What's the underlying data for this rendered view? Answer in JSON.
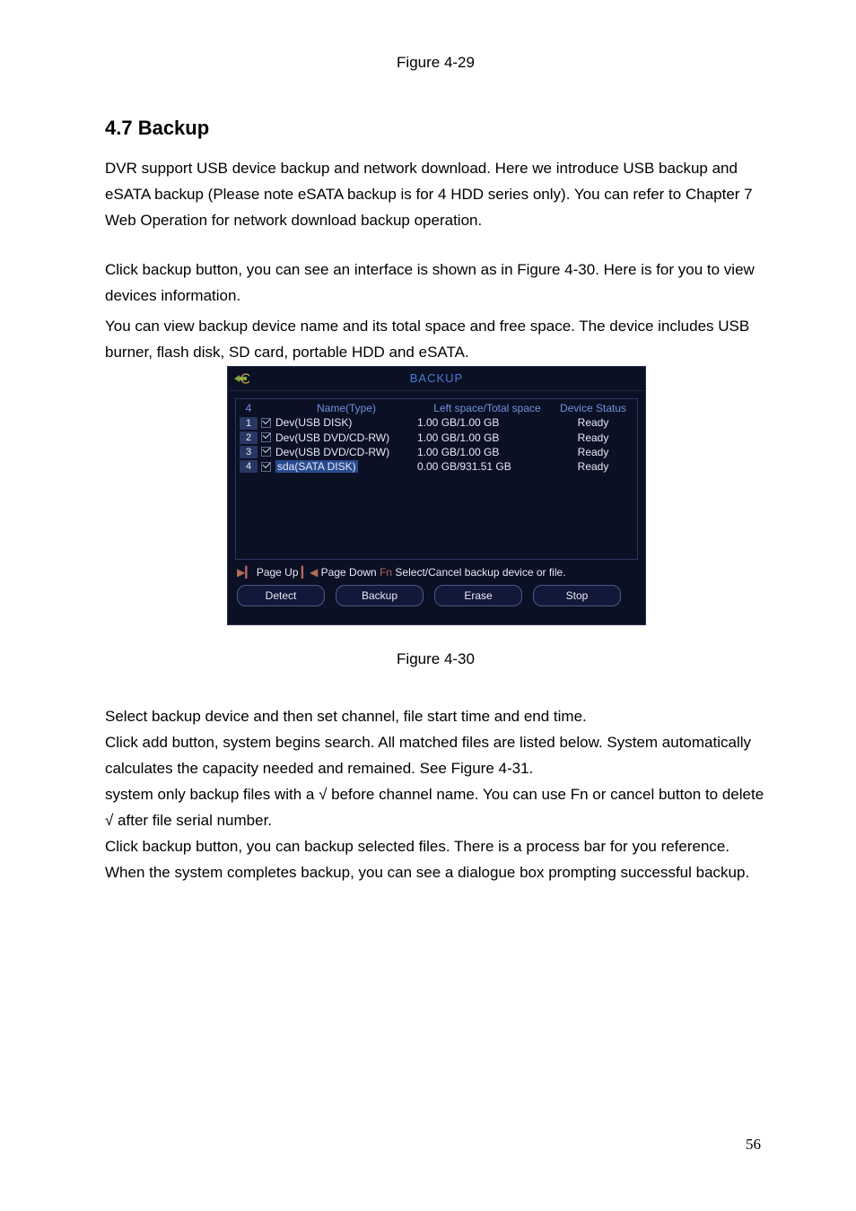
{
  "caption_top": "Figure 4-29",
  "heading": "4.7  Backup",
  "para1": "DVR support USB device backup and network download. Here we introduce USB backup and eSATA backup (Please note eSATA backup is for 4 HDD series only). You can refer to Chapter 7 Web Operation for network download backup operation.",
  "para2a": "Click backup button, you can see an interface is shown as in Figure 4-30. Here is for you to view devices information.",
  "para2b": "You can view backup device name and its total space and free space. The device includes USB burner, flash disk, SD card, portable HDD and eSATA.",
  "dialog": {
    "title": "BACKUP",
    "count": "4",
    "headers": {
      "name": "Name(Type)",
      "space": "Left space/Total space",
      "status": "Device Status"
    },
    "rows": [
      {
        "idx": "1",
        "name": "Dev(USB DISK)",
        "space": "1.00 GB/1.00 GB",
        "status": "Ready",
        "checked": true,
        "sel": false
      },
      {
        "idx": "2",
        "name": "Dev(USB DVD/CD-RW)",
        "space": "1.00 GB/1.00 GB",
        "status": "Ready",
        "checked": true,
        "sel": false
      },
      {
        "idx": "3",
        "name": "Dev(USB DVD/CD-RW)",
        "space": "1.00 GB/1.00 GB",
        "status": "Ready",
        "checked": true,
        "sel": false
      },
      {
        "idx": "4",
        "name": "sda(SATA DISK)",
        "space": "0.00 GB/931.51 GB",
        "status": "Ready",
        "checked": true,
        "sel": true
      }
    ],
    "hints": {
      "pageup_mark": "▶▎",
      "pageup": "Page Up",
      "pagedown_mark": "▎◀",
      "pagedown": "Page Down",
      "fn_mark": "Fn",
      "fn_text": "Select/Cancel backup device or file."
    },
    "buttons": {
      "detect": "Detect",
      "backup": "Backup",
      "erase": "Erase",
      "stop": "Stop"
    }
  },
  "caption_mid": "Figure 4-30",
  "para3a": "Select backup device and then set channel, file start time and end time.",
  "para3b": "Click add button, system begins search. All matched files are listed below. System automatically calculates the capacity needed and remained. See Figure 4-31.",
  "para3c": "system only backup files with a   √  before channel name. You can use Fn or cancel button to delete √ after file serial number.",
  "para3d": "Click backup button, you can backup selected files. There is a process bar for you reference. When the system completes backup, you can see a dialogue box prompting successful backup.",
  "page_number": "56"
}
